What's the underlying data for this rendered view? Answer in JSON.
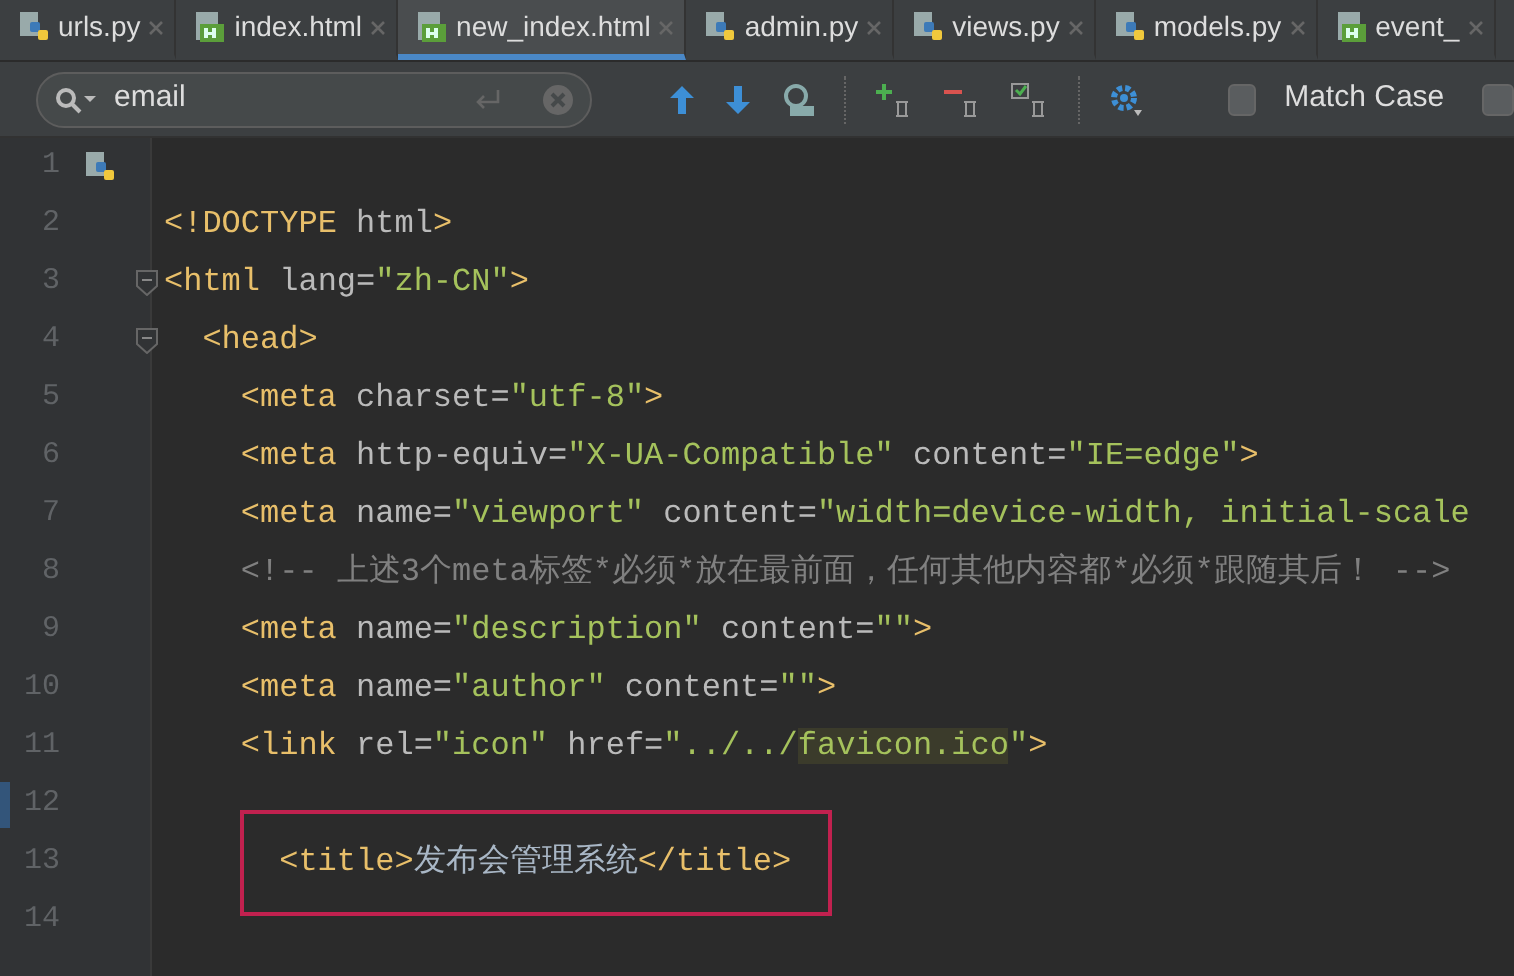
{
  "tabs": [
    {
      "label": "urls.py",
      "kind": "python",
      "selected": false
    },
    {
      "label": "index.html",
      "kind": "html",
      "selected": false
    },
    {
      "label": "new_index.html",
      "kind": "html",
      "selected": true
    },
    {
      "label": "admin.py",
      "kind": "python",
      "selected": false
    },
    {
      "label": "views.py",
      "kind": "python",
      "selected": false
    },
    {
      "label": "models.py",
      "kind": "python",
      "selected": false
    },
    {
      "label": "event_",
      "kind": "html",
      "selected": false
    }
  ],
  "search": {
    "value": "email",
    "match_case": {
      "label": "Match Case",
      "checked": false
    },
    "next_option": {
      "checked": false
    }
  },
  "lines": [
    {
      "number": "1",
      "file_icon": true
    },
    {
      "number": "2",
      "tokens": [
        {
          "kind": "tag",
          "text": "<!DOCTYPE"
        },
        {
          "kind": "plain",
          "text": " html"
        },
        {
          "kind": "tag",
          "text": ">"
        }
      ]
    },
    {
      "number": "3",
      "fold": true,
      "tokens": [
        {
          "kind": "tag",
          "text": "<html"
        },
        {
          "kind": "plain",
          "text": " lang="
        },
        {
          "kind": "str",
          "text": "\"zh-CN\""
        },
        {
          "kind": "tag",
          "text": ">"
        }
      ],
      "children": [
        {
          "number": "4",
          "fold": true,
          "tokens": [
            {
              "kind": "tag",
              "text": "<head>"
            }
          ],
          "children": [
            {
              "number": "5",
              "tokens": [
                {
                  "kind": "tag",
                  "text": "<meta"
                },
                {
                  "kind": "plain",
                  "text": " charset="
                },
                {
                  "kind": "str",
                  "text": "\"utf-8\""
                },
                {
                  "kind": "tag",
                  "text": ">"
                }
              ]
            },
            {
              "number": "6",
              "tokens": [
                {
                  "kind": "tag",
                  "text": "<meta"
                },
                {
                  "kind": "plain",
                  "text": " http-equiv="
                },
                {
                  "kind": "str",
                  "text": "\"X-UA-Compatible\""
                },
                {
                  "kind": "plain",
                  "text": " content="
                },
                {
                  "kind": "str",
                  "text": "\"IE=edge\""
                },
                {
                  "kind": "tag",
                  "text": ">"
                }
              ]
            },
            {
              "number": "7",
              "tokens": [
                {
                  "kind": "tag",
                  "text": "<meta"
                },
                {
                  "kind": "plain",
                  "text": " name="
                },
                {
                  "kind": "str",
                  "text": "\"viewport\""
                },
                {
                  "kind": "plain",
                  "text": " content="
                },
                {
                  "kind": "str",
                  "text": "\"width=device-width, initial-scale"
                }
              ]
            },
            {
              "number": "8",
              "tokens": [
                {
                  "kind": "comment",
                  "text": "<!-- 上述3个meta标签*必须*放在最前面，任何其他内容都*必须*跟随其后！ -->"
                }
              ]
            },
            {
              "number": "9",
              "tokens": [
                {
                  "kind": "tag",
                  "text": "<meta"
                },
                {
                  "kind": "plain",
                  "text": " name="
                },
                {
                  "kind": "str",
                  "text": "\"description\""
                },
                {
                  "kind": "plain",
                  "text": " content="
                },
                {
                  "kind": "str",
                  "text": "\"\""
                },
                {
                  "kind": "tag",
                  "text": ">"
                }
              ]
            },
            {
              "number": "10",
              "tokens": [
                {
                  "kind": "tag",
                  "text": "<meta"
                },
                {
                  "kind": "plain",
                  "text": " name="
                },
                {
                  "kind": "str",
                  "text": "\"author\""
                },
                {
                  "kind": "plain",
                  "text": " content="
                },
                {
                  "kind": "str",
                  "text": "\"\""
                },
                {
                  "kind": "tag",
                  "text": ">"
                }
              ]
            },
            {
              "number": "11",
              "tokens": [
                {
                  "kind": "tag",
                  "text": "<link"
                },
                {
                  "kind": "plain",
                  "text": " rel="
                },
                {
                  "kind": "str",
                  "text": "\"icon\""
                },
                {
                  "kind": "plain",
                  "text": " href="
                },
                {
                  "kind": "str",
                  "text": "\"../../"
                },
                {
                  "kind": "str_marked",
                  "text": "favicon.ico"
                },
                {
                  "kind": "str",
                  "text": "\""
                },
                {
                  "kind": "tag",
                  "text": ">"
                }
              ]
            },
            {
              "number": "12",
              "changed": true,
              "children": [
                {
                  "number": "13",
                  "boxed": true,
                  "tokens": [
                    {
                      "kind": "tag",
                      "text": "<title>"
                    },
                    {
                      "kind": "text",
                      "text": "发布会管理系统"
                    },
                    {
                      "kind": "tag",
                      "text": "</title>"
                    }
                  ]
                }
              ]
            },
            {
              "number": "14"
            }
          ]
        }
      ]
    }
  ]
}
